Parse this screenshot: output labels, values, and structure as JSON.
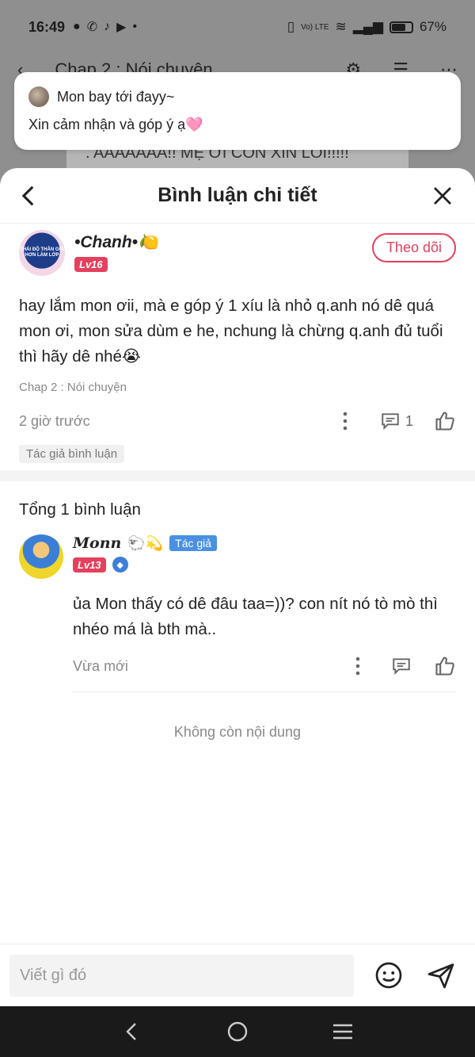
{
  "status_bar": {
    "time": "16:49",
    "battery": "67%",
    "volte": "Vo) LTE",
    "battery_level": 0.67
  },
  "background_app": {
    "header_title": "Chap 2 : Nói chuyện",
    "banner_text": ". AAAAAAA!! MẸ ƠI CON XIN LỖI!!!!!"
  },
  "notification": {
    "sender": "Mon bay tới đayy~",
    "message": "Xin cảm nhận và góp ý ạ🩷"
  },
  "sheet": {
    "title": "Bình luận chi tiết"
  },
  "main_comment": {
    "avatar_text": "THÁI ĐỘ THÂN GÓI HƠN LÀM LỚP",
    "author": "•Chanh•🍋",
    "level": "Lv16",
    "follow_label": "Theo dõi",
    "text": "hay lắm mon ơii, mà e góp ý 1 xíu là nhỏ q.anh nó dê quá mon ơi, mon sửa dùm e he, nchung là chừng q.anh đủ tuổi thì hãy dê nhé😭",
    "chapter": "Chap 2 : Nói chuyện",
    "time": "2 giờ trước",
    "reply_count": "1",
    "author_tag": "Tác giả bình luận"
  },
  "total_label": "Tổng 1 bình luận",
  "reply": {
    "author": "Monn",
    "author_emoji": "🐑💫",
    "author_badge": "Tác giả",
    "level": "Lv13",
    "text": "ủa Mon thấy có dê đâu taa=))? con nít nó tò mò thì nhéo má là bth mà..",
    "time": "Vừa mới"
  },
  "no_more_label": "Không còn nội dung",
  "input": {
    "placeholder": "Viết gì đó"
  },
  "colors": {
    "accent_pink": "#e5405e",
    "author_blue": "#4a90e2"
  },
  "icons": [
    "back-arrow-icon",
    "close-icon",
    "more-dots-icon",
    "comment-icon",
    "like-icon",
    "emoji-icon",
    "send-icon",
    "nav-back-icon",
    "nav-home-icon",
    "nav-menu-icon"
  ]
}
